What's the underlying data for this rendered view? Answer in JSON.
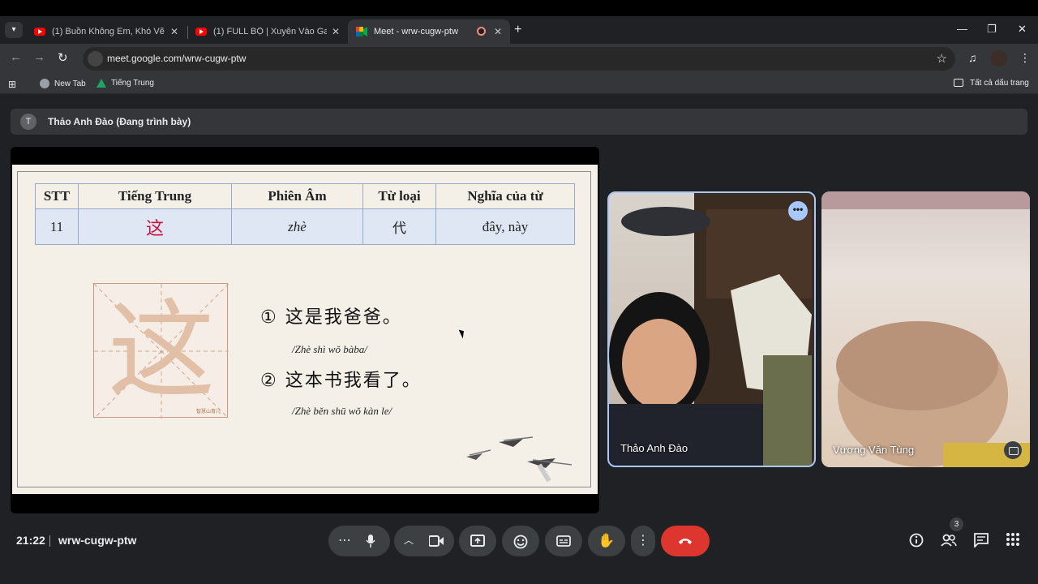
{
  "browser": {
    "tabs": [
      {
        "title": "(1) Buồn Không Em, Khó Vẽ Nụ",
        "close": "✕"
      },
      {
        "title": "(1) FULL BỘ | Xuyên Vào Game",
        "close": "✕"
      },
      {
        "title": "Meet - wrw-cugw-ptw",
        "close": "✕"
      }
    ],
    "new_tab": "+",
    "window_controls": {
      "minimize": "—",
      "restore": "❐",
      "close": "✕"
    },
    "url": "meet.google.com/wrw-cugw-ptw",
    "bookmarks": [
      {
        "label": "New Tab"
      },
      {
        "label": "Tiếng Trung"
      }
    ],
    "all_bookmarks": "Tất cả dấu trang"
  },
  "meet": {
    "presenter": {
      "initial": "T",
      "label": "Thảo Anh Đào (Đang trình bày)"
    },
    "slide": {
      "table": {
        "headers": [
          "STT",
          "Tiếng Trung",
          "Phiên Âm",
          "Từ loại",
          "Nghĩa của từ"
        ],
        "row": [
          "11",
          "这",
          "zhè",
          "代",
          "đây, này"
        ]
      },
      "big_char": "这",
      "stamp": "智慧山育儿",
      "sentences": [
        {
          "text": "① 这是我爸爸。",
          "pinyin": "/Zhè shì wǒ bàba/"
        },
        {
          "text": "② 这本书我看了。",
          "pinyin": "/Zhè běn shū wǒ kàn le/"
        }
      ]
    },
    "participants": [
      {
        "name": "Thảo Anh Đào"
      },
      {
        "name": "Vương Văn Tùng"
      }
    ],
    "bottom": {
      "time": "21:22",
      "code": "wrw-cugw-ptw",
      "people_count": "3"
    }
  },
  "colors": {
    "accent": "#a8c7fa",
    "end_call": "#dc362e",
    "zh_red": "#c8143c"
  }
}
